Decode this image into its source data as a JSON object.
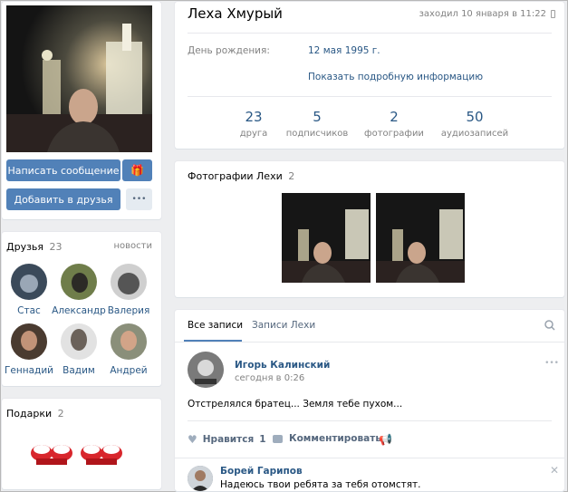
{
  "profile": {
    "name": "Леха Хмурый",
    "last_seen": "заходил 10 января в 11:22",
    "birthday_label": "День рождения:",
    "birthday_value": "12 мая 1995 г.",
    "show_details": "Показать подробную информацию"
  },
  "actions": {
    "message": "Написать сообщение",
    "add_friend": "Добавить в друзья",
    "more": "•••"
  },
  "counters": [
    {
      "num": "23",
      "label": "друга"
    },
    {
      "num": "5",
      "label": "подписчиков"
    },
    {
      "num": "2",
      "label": "фотографии"
    },
    {
      "num": "50",
      "label": "аудиозаписей"
    }
  ],
  "friends": {
    "title": "Друзья",
    "count": "23",
    "news_link": "новости",
    "items": [
      {
        "name": "Стас"
      },
      {
        "name": "Александр"
      },
      {
        "name": "Валерия"
      },
      {
        "name": "Геннадий"
      },
      {
        "name": "Вадим"
      },
      {
        "name": "Андрей"
      }
    ]
  },
  "gifts": {
    "title": "Подарки",
    "count": "2"
  },
  "photos": {
    "title": "Фотографии Лехи",
    "count": "2"
  },
  "wall": {
    "tab_all": "Все записи",
    "tab_own": "Записи Лехи",
    "post": {
      "author": "Игорь Калинский",
      "time": "сегодня в 0:26",
      "text": "Отстрелялся братец... Земля тебе пухом...",
      "like_label": "Нравится",
      "like_count": "1",
      "comment_label": "Комментировать"
    },
    "comment": {
      "author": "Борей Гарипов",
      "text": "Надеюсь твои ребята за тебя отомстят."
    }
  },
  "colors": {
    "accent": "#5181b8",
    "link": "#2a5885",
    "page_bg": "#edeef0"
  }
}
